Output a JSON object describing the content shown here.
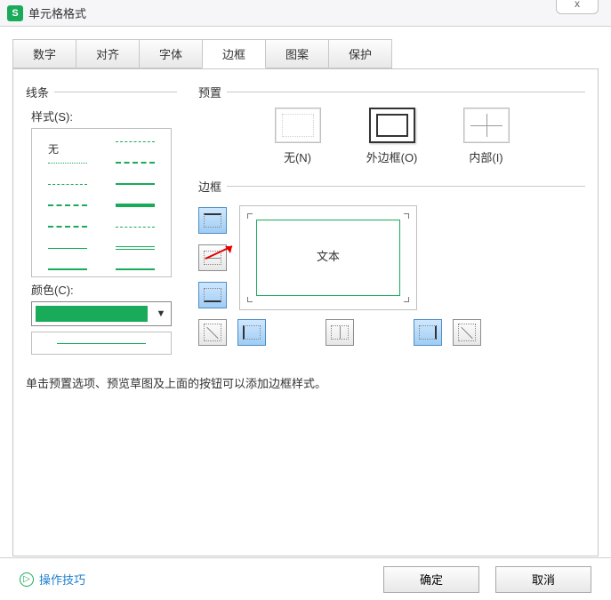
{
  "title": "单元格格式",
  "close_glyph": "x",
  "tabs": [
    {
      "label": "数字"
    },
    {
      "label": "对齐"
    },
    {
      "label": "字体"
    },
    {
      "label": "边框",
      "active": true
    },
    {
      "label": "图案"
    },
    {
      "label": "保护"
    }
  ],
  "line_section": {
    "legend": "线条"
  },
  "style_label": "样式(S):",
  "style_none_label": "无",
  "color_label": "颜色(C):",
  "color_value": "#1aab5a",
  "preset_section": {
    "legend": "预置"
  },
  "presets": {
    "none": "无(N)",
    "outer": "外边框(O)",
    "inner": "内部(I)"
  },
  "border_section": {
    "legend": "边框"
  },
  "preview_text": "文本",
  "hint": "单击预置选项、预览草图及上面的按钮可以添加边框样式。",
  "footer": {
    "tip": "操作技巧",
    "ok": "确定",
    "cancel": "取消"
  }
}
